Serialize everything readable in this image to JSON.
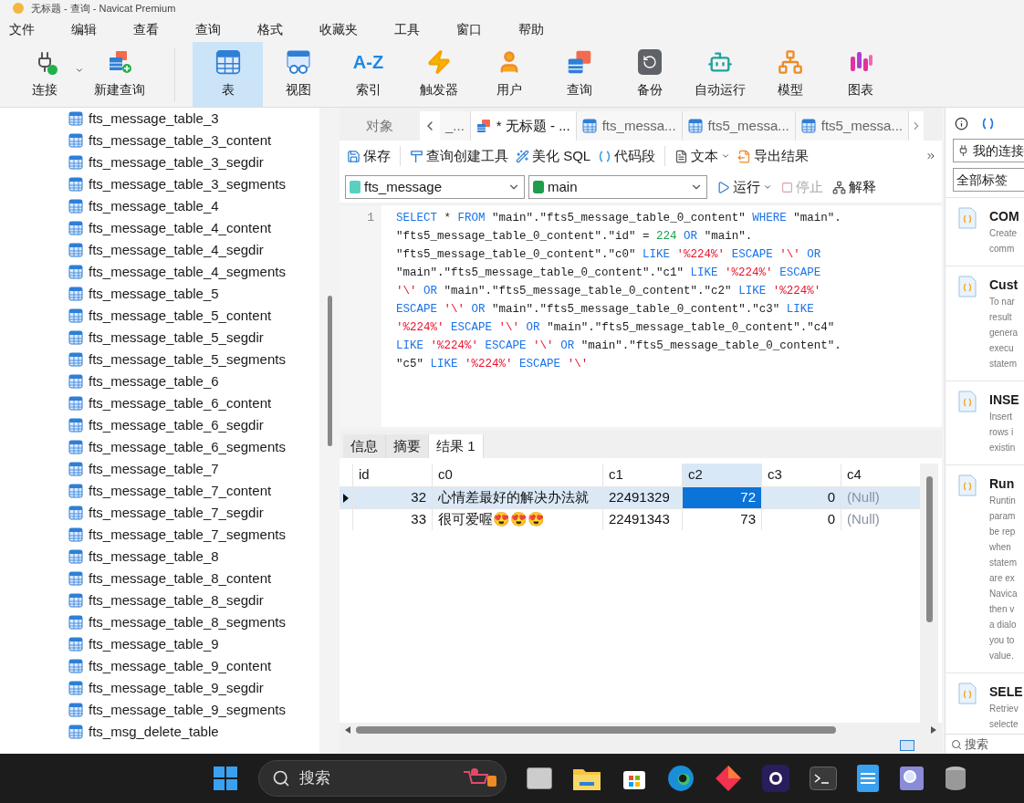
{
  "window": {
    "title": "无标题 - 查询 - Navicat Premium"
  },
  "menu": [
    "文件",
    "编辑",
    "查看",
    "查询",
    "格式",
    "收藏夹",
    "工具",
    "窗口",
    "帮助"
  ],
  "toolbar": [
    {
      "label": "连接",
      "selected": false
    },
    {
      "label": "新建查询",
      "selected": false
    },
    {
      "label": "表",
      "selected": true
    },
    {
      "label": "视图",
      "selected": false
    },
    {
      "label": "索引",
      "selected": false,
      "glyph": "A-Z"
    },
    {
      "label": "触发器",
      "selected": false
    },
    {
      "label": "用户",
      "selected": false
    },
    {
      "label": "查询",
      "selected": false
    },
    {
      "label": "备份",
      "selected": false
    },
    {
      "label": "自动运行",
      "selected": false
    },
    {
      "label": "模型",
      "selected": false
    },
    {
      "label": "图表",
      "selected": false
    }
  ],
  "object_tree": [
    "fts_message_table_3",
    "fts_message_table_3_content",
    "fts_message_table_3_segdir",
    "fts_message_table_3_segments",
    "fts_message_table_4",
    "fts_message_table_4_content",
    "fts_message_table_4_segdir",
    "fts_message_table_4_segments",
    "fts_message_table_5",
    "fts_message_table_5_content",
    "fts_message_table_5_segdir",
    "fts_message_table_5_segments",
    "fts_message_table_6",
    "fts_message_table_6_content",
    "fts_message_table_6_segdir",
    "fts_message_table_6_segments",
    "fts_message_table_7",
    "fts_message_table_7_content",
    "fts_message_table_7_segdir",
    "fts_message_table_7_segments",
    "fts_message_table_8",
    "fts_message_table_8_content",
    "fts_message_table_8_segdir",
    "fts_message_table_8_segments",
    "fts_message_table_9",
    "fts_message_table_9_content",
    "fts_message_table_9_segdir",
    "fts_message_table_9_segments",
    "fts_msg_delete_table"
  ],
  "object_tab": "对象",
  "doc_tabs": [
    {
      "label": "_...",
      "selected": false,
      "kind": "plain"
    },
    {
      "label": "* 无标题 - ...",
      "selected": true,
      "kind": "query"
    },
    {
      "label": "fts_messa...",
      "selected": false,
      "kind": "table"
    },
    {
      "label": "fts5_messa...",
      "selected": false,
      "kind": "table"
    },
    {
      "label": "fts5_messa...",
      "selected": false,
      "kind": "table"
    }
  ],
  "editor_toolbar": [
    "保存",
    "查询创建工具",
    "美化 SQL",
    "代码段",
    "文本",
    "导出结果"
  ],
  "connection_select": {
    "value": "fts_message"
  },
  "database_select": {
    "value": "main"
  },
  "run_button": "运行",
  "stop_button": {
    "label": "停止",
    "disabled": true
  },
  "explain_button": "解释",
  "editor": {
    "line_number": "1",
    "lines": [
      [
        {
          "kind": "keyword",
          "text": "SELECT"
        },
        {
          "kind": "plain",
          "text": "*"
        },
        {
          "kind": "keyword",
          "text": "FROM"
        },
        {
          "kind": "plain",
          "text": "\"main\".\"fts5_message_table_0_content\""
        },
        {
          "kind": "keyword",
          "text": "WHERE"
        },
        {
          "kind": "plain",
          "text": "\"main\"."
        }
      ],
      [
        {
          "kind": "plain",
          "text": "\"fts5_message_table_0_content\".\"id\" ="
        },
        {
          "kind": "number",
          "text": "224"
        },
        {
          "kind": "keyword",
          "text": "OR"
        },
        {
          "kind": "plain",
          "text": "\"main\"."
        }
      ],
      [
        {
          "kind": "plain",
          "text": "\"fts5_message_table_0_content\".\"c0\""
        },
        {
          "kind": "keyword",
          "text": "LIKE"
        },
        {
          "kind": "string",
          "text": "'%224%'"
        },
        {
          "kind": "keyword",
          "text": "ESCAPE"
        },
        {
          "kind": "string",
          "text": "'\\'"
        },
        {
          "kind": "keyword",
          "text": "OR"
        }
      ],
      [
        {
          "kind": "plain",
          "text": "\"main\".\"fts5_message_table_0_content\".\"c1\""
        },
        {
          "kind": "keyword",
          "text": "LIKE"
        },
        {
          "kind": "string",
          "text": "'%224%'"
        },
        {
          "kind": "keyword",
          "text": "ESCAPE"
        }
      ],
      [
        {
          "kind": "string",
          "text": "'\\'"
        },
        {
          "kind": "keyword",
          "text": "OR"
        },
        {
          "kind": "plain",
          "text": "\"main\".\"fts5_message_table_0_content\".\"c2\""
        },
        {
          "kind": "keyword",
          "text": "LIKE"
        },
        {
          "kind": "string",
          "text": "'%224%'"
        }
      ],
      [
        {
          "kind": "keyword",
          "text": "ESCAPE"
        },
        {
          "kind": "string",
          "text": "'\\'"
        },
        {
          "kind": "keyword",
          "text": "OR"
        },
        {
          "kind": "plain",
          "text": "\"main\".\"fts5_message_table_0_content\".\"c3\""
        },
        {
          "kind": "keyword",
          "text": "LIKE"
        }
      ],
      [
        {
          "kind": "string",
          "text": "'%224%'"
        },
        {
          "kind": "keyword",
          "text": "ESCAPE"
        },
        {
          "kind": "string",
          "text": "'\\'"
        },
        {
          "kind": "keyword",
          "text": "OR"
        },
        {
          "kind": "plain",
          "text": "\"main\".\"fts5_message_table_0_content\".\"c4\""
        }
      ],
      [
        {
          "kind": "keyword",
          "text": "LIKE"
        },
        {
          "kind": "string",
          "text": "'%224%'"
        },
        {
          "kind": "keyword",
          "text": "ESCAPE"
        },
        {
          "kind": "string",
          "text": "'\\'"
        },
        {
          "kind": "keyword",
          "text": "OR"
        },
        {
          "kind": "plain",
          "text": "\"main\".\"fts5_message_table_0_content\"."
        }
      ],
      [
        {
          "kind": "plain",
          "text": "\"c5\""
        },
        {
          "kind": "keyword",
          "text": "LIKE"
        },
        {
          "kind": "string",
          "text": "'%224%'"
        },
        {
          "kind": "keyword",
          "text": "ESCAPE"
        },
        {
          "kind": "string",
          "text": "'\\'"
        }
      ]
    ]
  },
  "result_tabs": [
    {
      "label": "信息",
      "selected": false
    },
    {
      "label": "摘要",
      "selected": false
    },
    {
      "label": "结果 1",
      "selected": true
    }
  ],
  "grid": {
    "columns": [
      {
        "label": "id",
        "kind": "number",
        "selected": false
      },
      {
        "label": "c0",
        "kind": "text",
        "selected": false
      },
      {
        "label": "c1",
        "kind": "text",
        "selected": false
      },
      {
        "label": "c2",
        "kind": "number",
        "selected": true
      },
      {
        "label": "c3",
        "kind": "number",
        "selected": false
      },
      {
        "label": "c4",
        "kind": "text",
        "selected": false
      }
    ],
    "rows": [
      {
        "selected": true,
        "cells": [
          {
            "text": "32",
            "selected": false,
            "null": false
          },
          {
            "text": "心情差最好的解决办法就",
            "selected": false,
            "null": false
          },
          {
            "text": "22491329",
            "selected": false,
            "null": false
          },
          {
            "text": "72",
            "selected": true,
            "null": false
          },
          {
            "text": "0",
            "selected": false,
            "null": false
          },
          {
            "text": "(Null)",
            "selected": false,
            "null": true
          }
        ]
      },
      {
        "selected": false,
        "cells": [
          {
            "text": "33",
            "selected": false,
            "null": false
          },
          {
            "text": "很可爱喔😍😍😍",
            "selected": false,
            "null": false
          },
          {
            "text": "22491343",
            "selected": false,
            "null": false
          },
          {
            "text": "73",
            "selected": false,
            "null": false
          },
          {
            "text": "0",
            "selected": false,
            "null": false
          },
          {
            "text": "(Null)",
            "selected": false,
            "null": true
          }
        ]
      }
    ]
  },
  "snippets": {
    "connection_filter": "我的连接",
    "tag_filter": "全部标签",
    "items": [
      {
        "title": "COM",
        "lines": [
          "Create",
          "comm"
        ]
      },
      {
        "title": "Cust",
        "lines": [
          "To nar",
          "result",
          "genera",
          "execu",
          "statem"
        ]
      },
      {
        "title": "INSE",
        "lines": [
          "Insert",
          "rows i",
          "existin"
        ]
      },
      {
        "title": "Run",
        "lines": [
          "Runtin",
          "param",
          "be rep",
          "when",
          "statem",
          "are ex",
          "Navica",
          "then v",
          "a dialo",
          "you to",
          "value."
        ]
      },
      {
        "title": "SELE",
        "lines": [
          "Retriev",
          "selecte"
        ]
      }
    ],
    "search_placeholder": "搜索"
  },
  "taskbar": {
    "search_label": "搜索"
  }
}
